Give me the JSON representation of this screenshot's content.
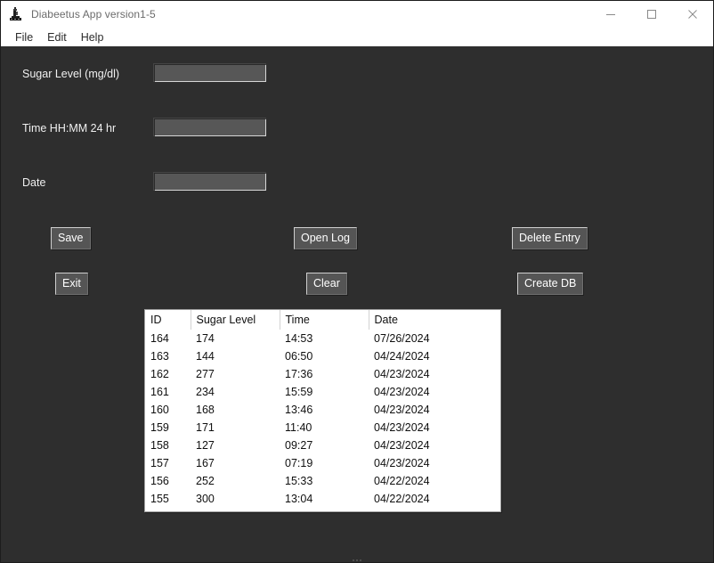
{
  "window": {
    "title": "Diabeetus App version1-5",
    "icon": "app-figure-icon",
    "controls": {
      "minimize": "minimize-icon",
      "maximize": "maximize-icon",
      "close": "close-icon"
    }
  },
  "menubar": {
    "items": [
      {
        "label": "File"
      },
      {
        "label": "Edit"
      },
      {
        "label": "Help"
      }
    ]
  },
  "form": {
    "fields": [
      {
        "label": "Sugar Level (mg/dl)",
        "value": "",
        "placeholder": ""
      },
      {
        "label": "Time HH:MM 24 hr",
        "value": "",
        "placeholder": ""
      },
      {
        "label": "Date",
        "value": "",
        "placeholder": ""
      }
    ]
  },
  "buttons": {
    "save": "Save",
    "exit": "Exit",
    "open_log": "Open Log",
    "clear": "Clear",
    "delete_entry": "Delete Entry",
    "create_db": "Create DB"
  },
  "table": {
    "columns": [
      "ID",
      "Sugar Level",
      "Time",
      "Date"
    ],
    "rows": [
      [
        "164",
        "174",
        "14:53",
        "07/26/2024"
      ],
      [
        "163",
        "144",
        "06:50",
        "04/24/2024"
      ],
      [
        "162",
        "277",
        "17:36",
        "04/23/2024"
      ],
      [
        "161",
        "234",
        "15:59",
        "04/23/2024"
      ],
      [
        "160",
        "168",
        "13:46",
        "04/23/2024"
      ],
      [
        "159",
        "171",
        "11:40",
        "04/23/2024"
      ],
      [
        "158",
        "127",
        "09:27",
        "04/23/2024"
      ],
      [
        "157",
        "167",
        "07:19",
        "04/23/2024"
      ],
      [
        "156",
        "252",
        "15:33",
        "04/22/2024"
      ],
      [
        "155",
        "300",
        "13:04",
        "04/22/2024"
      ]
    ]
  },
  "colors": {
    "window_background": "#2e2e2e",
    "titlebar_background": "#ffffff",
    "title_text": "#6b6b6b",
    "label_text": "#f0f0f0",
    "input_background": "#575757",
    "button_background": "#555555",
    "table_background": "#ffffff",
    "table_text": "#101010"
  }
}
